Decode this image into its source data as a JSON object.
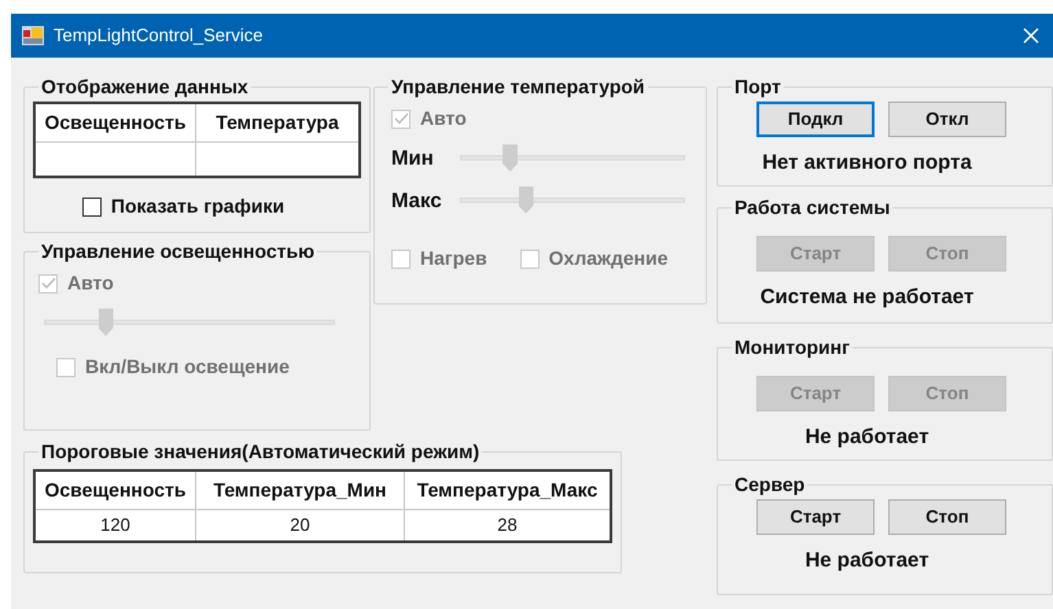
{
  "window": {
    "title": "TempLightControl_Service"
  },
  "data_display": {
    "title": "Отображение данных",
    "table": {
      "columns": [
        "Освещенность",
        "Температура"
      ]
    },
    "show_charts": {
      "label": "Показать графики",
      "checked": false,
      "disabled": false
    }
  },
  "light_control": {
    "title": "Управление освещенностью",
    "auto": {
      "label": "Авто",
      "checked": true,
      "disabled": true
    },
    "slider": {
      "level": 0.21
    },
    "toggle": {
      "label": "Вкл/Выкл освещение",
      "checked": false,
      "disabled": true
    }
  },
  "temperature_control": {
    "title": "Управление температурой",
    "auto": {
      "label": "Авто",
      "checked": true,
      "disabled": true
    },
    "sliders": [
      {
        "label": "Мин",
        "level": 0.22
      },
      {
        "label": "Макс",
        "level": 0.29
      }
    ],
    "options": [
      {
        "label": "Нагрев",
        "checked": false,
        "disabled": true
      },
      {
        "label": "Охлаждение",
        "checked": false,
        "disabled": true
      }
    ]
  },
  "thresholds": {
    "title": "Пороговые значения(Автоматический режим)",
    "table": {
      "columns": [
        "Освещенность",
        "Температура_Мин",
        "Температура_Макс"
      ],
      "rows": [
        [
          "120",
          "20",
          "28"
        ]
      ]
    }
  },
  "right_groups": [
    {
      "title": "Порт",
      "buttons": [
        {
          "label": "Подкл",
          "disabled": false,
          "focused": true
        },
        {
          "label": "Откл",
          "disabled": false,
          "focused": false
        }
      ],
      "status": "Нет активного порта"
    },
    {
      "title": "Работа системы",
      "buttons": [
        {
          "label": "Старт",
          "disabled": true,
          "focused": false
        },
        {
          "label": "Стоп",
          "disabled": true,
          "focused": false
        }
      ],
      "status": "Система не работает"
    },
    {
      "title": "Мониторинг",
      "buttons": [
        {
          "label": "Старт",
          "disabled": true,
          "focused": false
        },
        {
          "label": "Стоп",
          "disabled": true,
          "focused": false
        }
      ],
      "status": "Не работает"
    },
    {
      "title": "Сервер",
      "buttons": [
        {
          "label": "Старт",
          "disabled": false,
          "focused": false
        },
        {
          "label": "Стоп",
          "disabled": false,
          "focused": false
        }
      ],
      "status": "Не работает"
    }
  ]
}
